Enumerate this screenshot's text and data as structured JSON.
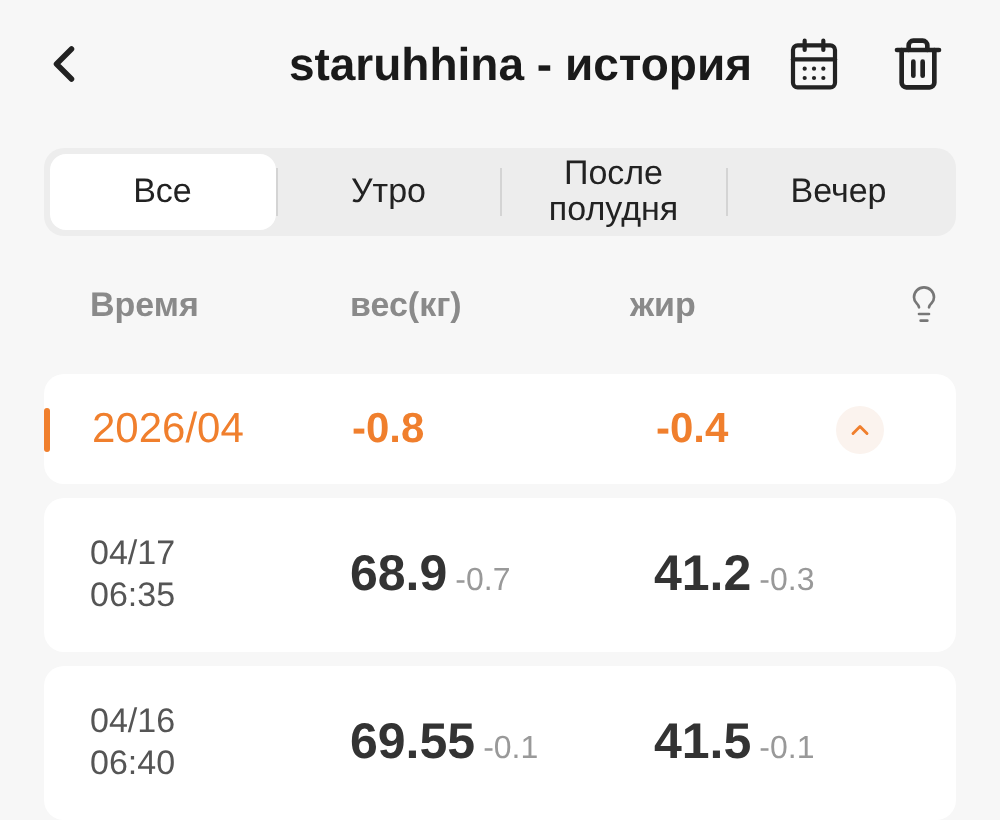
{
  "header": {
    "title": "staruhhina - история"
  },
  "tabs": [
    {
      "label": "Все",
      "selected": true
    },
    {
      "label": "Утро",
      "selected": false
    },
    {
      "label": "После полудня",
      "selected": false
    },
    {
      "label": "Вечер",
      "selected": false
    }
  ],
  "columns": [
    "Время",
    "вес(кг)",
    "жир"
  ],
  "month": {
    "label": "2026/04",
    "weight_change": "-0.8",
    "fat_change": "-0.4",
    "expanded": true
  },
  "rows": [
    {
      "date": "04/17",
      "time": "06:35",
      "weight": "68.9",
      "weight_change": "-0.7",
      "fat": "41.2",
      "fat_change": "-0.3"
    },
    {
      "date": "04/16",
      "time": "06:40",
      "weight": "69.55",
      "weight_change": "-0.1",
      "fat": "41.5",
      "fat_change": "-0.1"
    }
  ]
}
